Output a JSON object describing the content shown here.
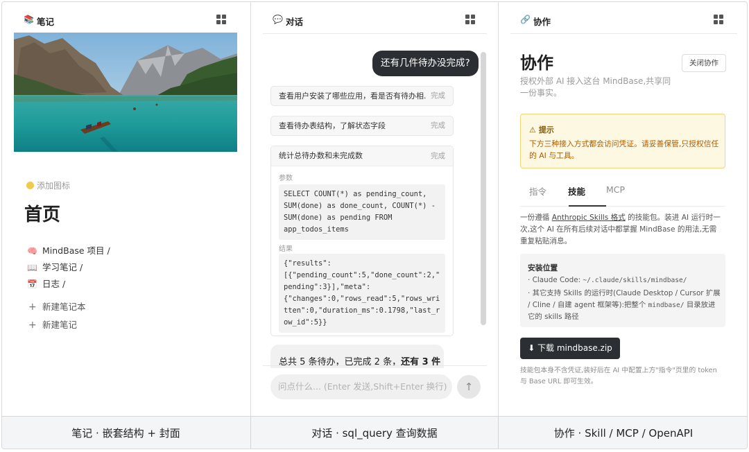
{
  "notes": {
    "header_title": "笔记",
    "header_icon": "book-icon",
    "add_icon_label": "添加图标",
    "page_title": "首页",
    "notebooks": [
      {
        "icon": "brain-icon",
        "glyph": "🧠",
        "label": "MindBase 项目 /"
      },
      {
        "icon": "open-book-icon",
        "glyph": "📖",
        "label": "学习笔记 /"
      },
      {
        "icon": "calendar-icon",
        "glyph": "📅",
        "label": "日志 /"
      }
    ],
    "new_notebook": "新建笔记本",
    "new_note": "新建笔记"
  },
  "chat": {
    "header_title": "对话",
    "header_icon": "chat-bubble-icon",
    "user_message": "还有几件待办没完成?",
    "steps": [
      {
        "title": "查看用户安装了哪些应用，看是否有待办相...",
        "status": "完成"
      },
      {
        "title": "查看待办表结构，了解状态字段",
        "status": "完成"
      }
    ],
    "expanded_step": {
      "title": "统计总待办数和未完成数",
      "status": "完成",
      "params_label": "参数",
      "params_code": "SELECT COUNT(*) as pending_count,\nSUM(done) as done_count, COUNT(*) -\nSUM(done) as pending FROM\napp_todos_items",
      "result_label": "结果",
      "result_code": "{\"results\":\n[{\"pending_count\":5,\"done_count\":2,\"\npending\":3}],\"meta\":\n{\"changes\":0,\"rows_read\":5,\"rows_wri\ntten\":0,\"duration_ms\":0.1798,\"last_r\now_id\":5}}"
    },
    "answer_prefix": "总共 5 条待办，已完成 2 条，",
    "answer_bold": "还有 3 件",
    "input_placeholder": "问点什么... (Enter 发送,Shift+Enter 换行)",
    "send_icon": "arrow-up-icon"
  },
  "collab": {
    "header_title": "协作",
    "header_icon": "link-icon",
    "title": "协作",
    "close_button": "关闭协作",
    "description": "授权外部 AI 接入这台 MindBase,共享同一份事实。",
    "tip_title": "提示",
    "tip_icon": "warning-icon",
    "tip_body": "下方三种接入方式都会访问凭证。请妥善保管,只授权信任的 AI 与工具。",
    "tabs": [
      "指令",
      "技能",
      "MCP"
    ],
    "active_tab": "技能",
    "skill_desc_pre": "一份遵循 ",
    "skill_desc_link": "Anthropic Skills 格式",
    "skill_desc_post": " 的技能包。装进 AI 运行时一次,这个 AI 在所有后续对话中都掌握 MindBase 的用法,无需重复粘贴消息。",
    "install_title": "安装位置",
    "install_line1_pre": "· Claude Code: ",
    "install_line1_path": "~/.claude/skills/mindbase/",
    "install_line2_pre": "· 其它支持 Skills 的运行时(Claude Desktop / Cursor 扩展 / Cline / 自建 agent 框架等):把整个 ",
    "install_line2_path": "mindbase/",
    "install_line2_post": " 目录放进它的 skills 路径",
    "download_button": "⬇ 下载 mindbase.zip",
    "footnote": "技能包本身不含凭证,装好后在 AI 中配置上方\"指令\"页里的 token 与 Base URL 即可生效。"
  },
  "captions": {
    "notes": "笔记 · 嵌套结构 + 封面",
    "chat": "对话 · sql_query 查询数据",
    "collab": "协作 · Skill / MCP / OpenAPI"
  },
  "colors": {
    "dark_button": "#2b2f33",
    "tip_background": "#fdf8e1",
    "tip_border": "#f1d577",
    "tip_text": "#b05a00"
  }
}
